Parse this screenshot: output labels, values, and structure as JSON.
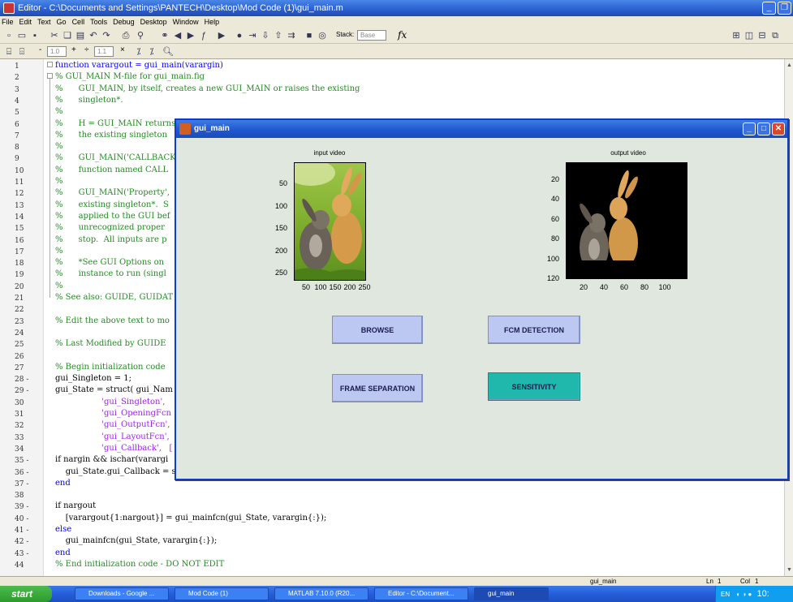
{
  "editor_window": {
    "title": "Editor - C:\\Documents and Settings\\PANTECH\\Desktop\\Mod Code (1)\\gui_main.m",
    "menu": [
      "File",
      "Edit",
      "Text",
      "Go",
      "Cell",
      "Tools",
      "Debug",
      "Desktop",
      "Window",
      "Help"
    ],
    "toolbar": {
      "stack_label": "Stack:",
      "stack_value": "Base",
      "fx_label": "fx",
      "cell_size_1": "1.0",
      "cell_size_2": "1.1",
      "plus_label": "+",
      "minus_label": "-",
      "divide_label": "÷",
      "times_label": "×"
    },
    "line_numbers": [
      "1",
      "2",
      "3",
      "4",
      "5",
      "6",
      "7",
      "8",
      "9",
      "10",
      "11",
      "12",
      "13",
      "14",
      "15",
      "16",
      "17",
      "18",
      "19",
      "20",
      "21",
      "22",
      "23",
      "24",
      "25",
      "26",
      "27",
      "28 -",
      "29 -",
      "30",
      "31",
      "32",
      "33",
      "34",
      "35 -",
      "36 -",
      "37 -",
      "38",
      "39 -",
      "40 -",
      "41 -",
      "42 -",
      "43 -",
      "44"
    ],
    "code_lines": [
      {
        "t": "function varargout = gui_main(varargin)",
        "c": "kw"
      },
      {
        "t": "% GUI_MAIN M-file for gui_main.fig",
        "c": "cm"
      },
      {
        "t": "%      GUI_MAIN, by itself, creates a new GUI_MAIN or raises the existing",
        "c": "cm"
      },
      {
        "t": "%      singleton*.",
        "c": "cm"
      },
      {
        "t": "%",
        "c": "cm"
      },
      {
        "t": "%      H = GUI_MAIN returns",
        "c": "cm"
      },
      {
        "t": "%      the existing singleton",
        "c": "cm"
      },
      {
        "t": "%",
        "c": "cm"
      },
      {
        "t": "%      GUI_MAIN('CALLBACK",
        "c": "cm"
      },
      {
        "t": "%      function named CALL",
        "c": "cm"
      },
      {
        "t": "%",
        "c": "cm"
      },
      {
        "t": "%      GUI_MAIN('Property',",
        "c": "cm"
      },
      {
        "t": "%      existing singleton*.  S",
        "c": "cm"
      },
      {
        "t": "%      applied to the GUI bef",
        "c": "cm"
      },
      {
        "t": "%      unrecognized proper",
        "c": "cm"
      },
      {
        "t": "%      stop.  All inputs are p",
        "c": "cm"
      },
      {
        "t": "%",
        "c": "cm"
      },
      {
        "t": "%      *See GUI Options on",
        "c": "cm"
      },
      {
        "t": "%      instance to run (singl",
        "c": "cm"
      },
      {
        "t": "%",
        "c": "cm"
      },
      {
        "t": "% See also: GUIDE, GUIDAT",
        "c": "cm"
      },
      {
        "t": "",
        "c": ""
      },
      {
        "t": "% Edit the above text to mo",
        "c": "cm"
      },
      {
        "t": "",
        "c": ""
      },
      {
        "t": "% Last Modified by GUIDE",
        "c": "cm"
      },
      {
        "t": "",
        "c": ""
      },
      {
        "t": "% Begin initialization code",
        "c": "cm"
      },
      {
        "t": "gui_Singleton = 1;",
        "c": ""
      },
      {
        "t": "gui_State = struct( gui_Nam",
        "c": "mix1"
      },
      {
        "t": "                  'gui_Singleton',",
        "c": "st"
      },
      {
        "t": "                  'gui_OpeningFcn",
        "c": "st"
      },
      {
        "t": "                  'gui_OutputFcn',",
        "c": "st"
      },
      {
        "t": "                  'gui_LayoutFcn',",
        "c": "st"
      },
      {
        "t": "                  'gui_Callback',   [",
        "c": "st"
      },
      {
        "t": "if nargin && ischar(varargi",
        "c": "kwl"
      },
      {
        "t": "    gui_State.gui_Callback = s",
        "c": ""
      },
      {
        "t": "end",
        "c": "kw"
      },
      {
        "t": "",
        "c": ""
      },
      {
        "t": "if nargout",
        "c": "kwl"
      },
      {
        "t": "    [varargout{1:nargout}] = gui_mainfcn(gui_State, varargin{:});",
        "c": ""
      },
      {
        "t": "else",
        "c": "kw"
      },
      {
        "t": "    gui_mainfcn(gui_State, varargin{:});",
        "c": ""
      },
      {
        "t": "end",
        "c": "kw"
      },
      {
        "t": "% End initialization code - DO NOT EDIT",
        "c": "cm"
      }
    ],
    "status": {
      "script": "gui_main",
      "ln_label": "Ln",
      "ln": "1",
      "col_label": "Col",
      "col": "1"
    }
  },
  "gui": {
    "title": "gui_main",
    "input_axes": {
      "title": "input video",
      "y_ticks": [
        "50",
        "100",
        "150",
        "200",
        "250"
      ],
      "x_ticks": [
        "50",
        "100",
        "150",
        "200",
        "250"
      ]
    },
    "output_axes": {
      "title": "output video",
      "y_ticks": [
        "20",
        "40",
        "60",
        "80",
        "100",
        "120"
      ],
      "x_ticks": [
        "20",
        "40",
        "60",
        "80",
        "100"
      ]
    },
    "buttons": {
      "browse": "BROWSE",
      "fcm": "FCM DETECTION",
      "frame": "FRAME SEPARATION",
      "sensitivity": "SENSITIVITY"
    }
  },
  "taskbar": {
    "start": "start",
    "tasks": [
      "Downloads - Google ...",
      "Mod Code (1)",
      "MATLAB 7.10.0 (R20...",
      "Editor - C:\\Document...",
      "gui_main"
    ],
    "tray_lang": "EN",
    "clock": "10:"
  },
  "colors": {
    "comment": "#228b22",
    "keyword": "#0000ff",
    "string": "#a020f0",
    "gui_bg": "#dfe7df",
    "teal_button": "#20b8ac",
    "blue_button": "#bcc8f2"
  }
}
